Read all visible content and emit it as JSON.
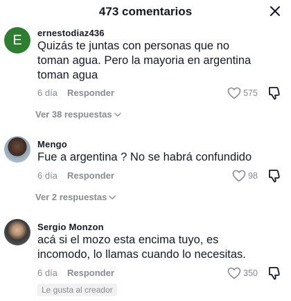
{
  "header": {
    "title": "473 comentarios"
  },
  "comments": [
    {
      "avatar_letter": "E",
      "avatar_color": "#2e7d32",
      "username": "ernestodiaz436",
      "text": "Quizás te juntas con personas que no toman agua. Pero la mayoria en argentina toman agua",
      "time": "6 día",
      "reply_label": "Responder",
      "likes": "575",
      "view_replies": "Ver 38 respuestas"
    },
    {
      "username": "Mengo",
      "text": "Fue a argentina ? No se habrá confundido",
      "time": "6 día",
      "reply_label": "Responder",
      "likes": "98",
      "view_replies": "Ver 2 respuestas"
    },
    {
      "username": "Sergio Monzon",
      "text": "acá si el mozo esta encima tuyo, es incomodo, lo llamas cuando lo necesitas.",
      "time": "6 día",
      "reply_label": "Responder",
      "likes": "350",
      "badge": "Le gusta al creador"
    }
  ]
}
